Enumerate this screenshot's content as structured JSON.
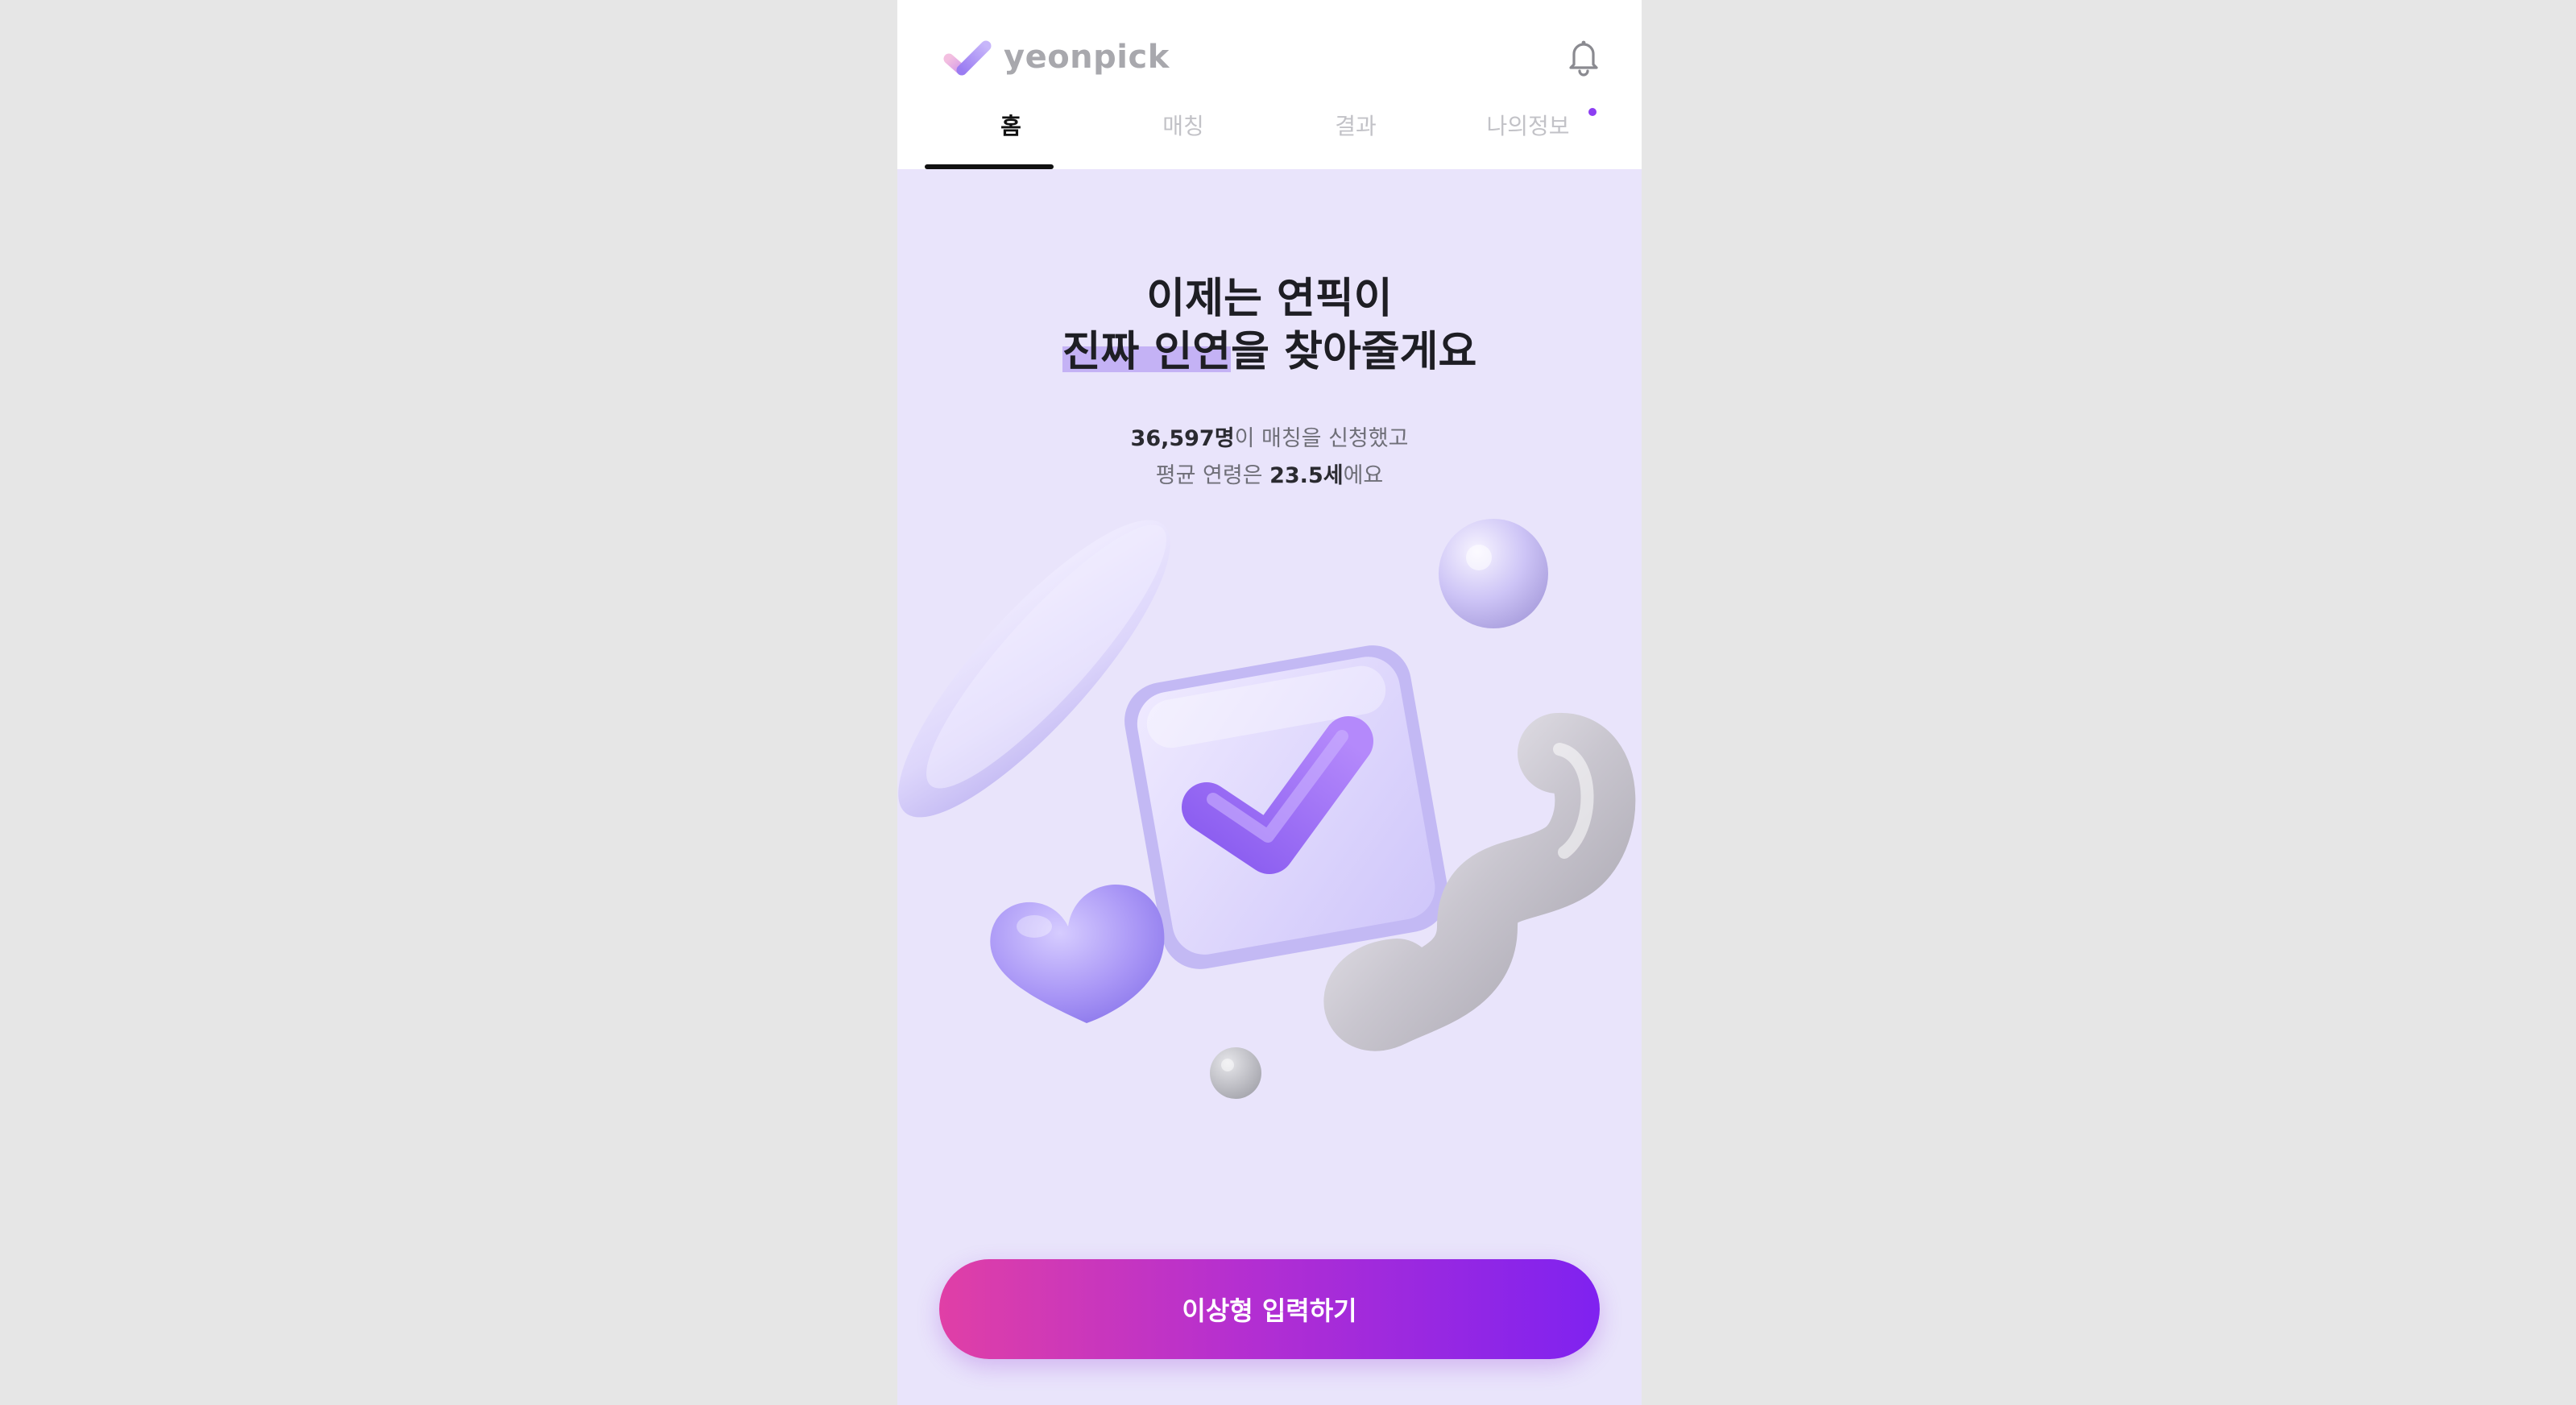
{
  "app": {
    "name": "yeonpick",
    "icons": {
      "logo": "check-logo-icon",
      "notifications": "bell-icon"
    }
  },
  "tabs": [
    {
      "label": "홈",
      "active": true
    },
    {
      "label": "매칭",
      "active": false
    },
    {
      "label": "결과",
      "active": false
    },
    {
      "label": "나의정보",
      "active": false,
      "has_badge_dot": true
    }
  ],
  "hero": {
    "headline_line1": "이제는 연픽이",
    "headline_line2_highlight": "진짜 인연",
    "headline_line2_rest": "을 찾아줄게요",
    "stats_count": "36,597명",
    "stats_line1_rest": "이 매칭을 신청했고",
    "stats_line2_prefix": "평균 연령은 ",
    "stats_age": "23.5세",
    "stats_line2_suffix": "에요"
  },
  "cta": {
    "label": "이상형 입력하기"
  },
  "colors": {
    "accent": "#8c3ef2",
    "background": "#e9e4fb",
    "cta_gradient_start": "#e03fa6",
    "cta_gradient_end": "#7f22f0"
  }
}
